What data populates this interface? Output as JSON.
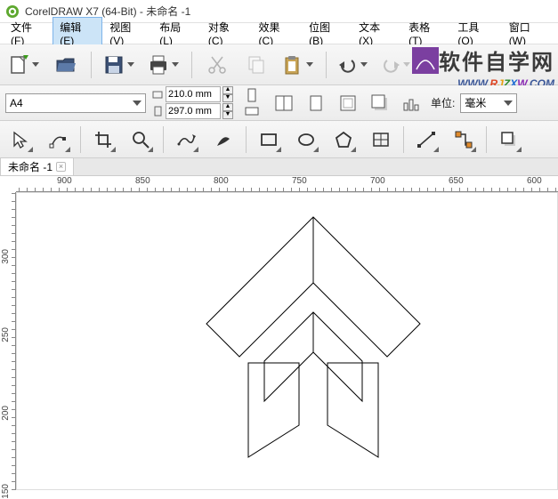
{
  "title": "CorelDRAW X7 (64-Bit) - 未命名 -1",
  "menu": {
    "file": "文件(F)",
    "edit": "编辑(E)",
    "view": "视图(V)",
    "layout": "布局(L)",
    "object": "对象(C)",
    "effect": "效果(C)",
    "bitmap": "位图(B)",
    "text": "文本(X)",
    "table": "表格(T)",
    "tools": "工具(O)",
    "window": "窗口(W)"
  },
  "propbar": {
    "paper": "A4",
    "width": "210.0 mm",
    "height": "297.0 mm",
    "units_label": "单位:",
    "units_value": "毫米"
  },
  "tabs": {
    "doc1": "未命名 -1"
  },
  "ruler_h": [
    "900",
    "850",
    "800",
    "750",
    "700",
    "650",
    "600"
  ],
  "ruler_v": [
    "300",
    "250",
    "200",
    "150"
  ],
  "watermark": {
    "cn": "软件自学网",
    "url_pre": "WWW.",
    "url_r": "R",
    "url_j": "J",
    "url_z": "Z",
    "url_x": "X",
    "url_w": "W",
    "url_post": ".COM"
  }
}
